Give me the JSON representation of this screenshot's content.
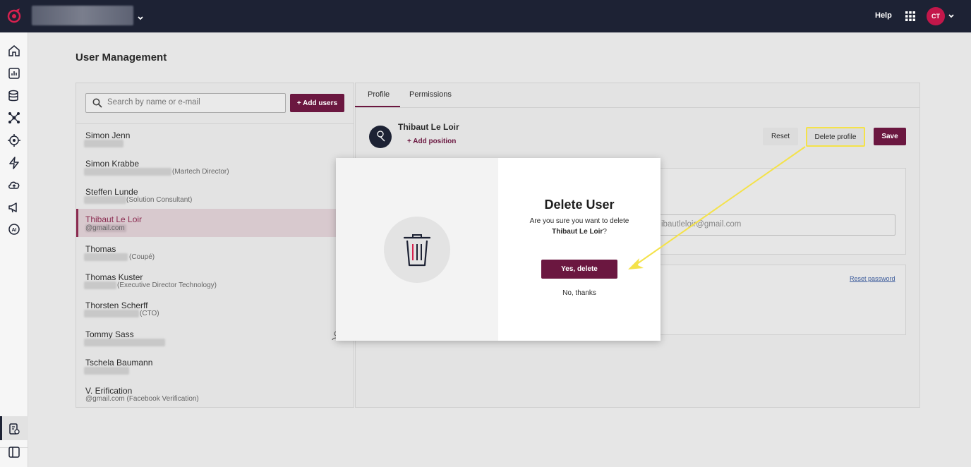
{
  "topbar": {
    "help_label": "Help",
    "avatar_initials": "CT"
  },
  "page": {
    "title": "User Management"
  },
  "search": {
    "placeholder": "Search by name or e-mail",
    "add_users_label": "+ Add users"
  },
  "users": [
    {
      "name": "Simon Jenn",
      "sub": ""
    },
    {
      "name": "Simon Krabbe",
      "sub": "(Martech Director)"
    },
    {
      "name": "Steffen Lunde",
      "sub": "(Solution Consultant)"
    },
    {
      "name": "Thibaut Le Loir",
      "sub": "@gmail.com",
      "selected": true
    },
    {
      "name": "Thomas",
      "sub": "(Coupé)"
    },
    {
      "name": "Thomas Kuster",
      "sub": "(Executive Director Technology)"
    },
    {
      "name": "Thorsten Scherff",
      "sub": "(CTO)"
    },
    {
      "name": "Tommy Sass",
      "sub": ""
    },
    {
      "name": "Tschela Baumann",
      "sub": ""
    },
    {
      "name": "V. Erification",
      "sub": "@gmail.com (Facebook Verification)"
    }
  ],
  "tabs": [
    {
      "label": "Profile",
      "active": true
    },
    {
      "label": "Permissions",
      "active": false
    }
  ],
  "profile": {
    "name": "Thibaut Le Loir",
    "add_position_label": "+ Add position",
    "reset_label": "Reset",
    "delete_profile_label": "Delete profile",
    "save_label": "Save",
    "email_value": "ibautleloir@gmail.com",
    "reset_password_label": "Reset password"
  },
  "modal": {
    "title": "Delete User",
    "question": "Are you sure you want to delete",
    "user_name": "Thibaut Le Loir",
    "question_mark": "?",
    "confirm_label": "Yes, delete",
    "cancel_label": "No, thanks"
  },
  "colors": {
    "topbar_bg": "#1d2234",
    "accent": "#6b1740",
    "avatar_bg": "#c3174a",
    "highlight": "#f4e24a"
  },
  "icons": {
    "sidebar": [
      "home-icon",
      "analytics-icon",
      "database-icon",
      "network-icon",
      "target-icon",
      "lightning-icon",
      "cloud-icon",
      "megaphone-icon",
      "ai-icon",
      "user-settings-icon",
      "panel-icon"
    ]
  }
}
